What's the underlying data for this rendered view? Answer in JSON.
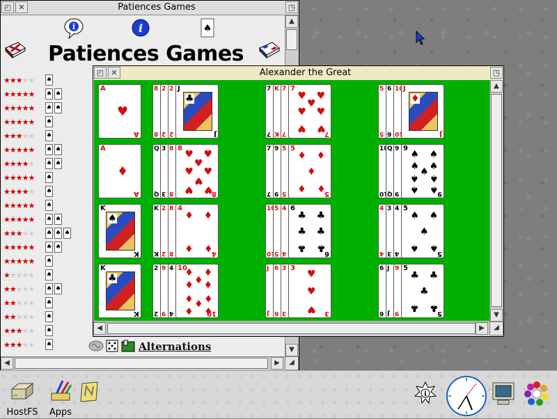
{
  "desktop": {
    "pointer_icon": "arrow-pointer-icon"
  },
  "patiences_window": {
    "title": "Patiences Games",
    "heading": "Patiences Games",
    "toolbar": {
      "help_icon": "help-bubble-icon",
      "info_icon": "info-icon",
      "card_icon": "spade-card-icon"
    },
    "language_icons": [
      "uk-book-icon",
      "fr-book-icon"
    ],
    "rows": [
      {
        "rating": 3,
        "cards": 1
      },
      {
        "rating": 5,
        "cards": 2
      },
      {
        "rating": 5,
        "cards": 2
      },
      {
        "rating": 5,
        "cards": 1
      },
      {
        "rating": 3,
        "cards": 1
      },
      {
        "rating": 5,
        "cards": 2
      },
      {
        "rating": 4,
        "cards": 2
      },
      {
        "rating": 5,
        "cards": 1
      },
      {
        "rating": 4,
        "cards": 1
      },
      {
        "rating": 5,
        "cards": 1
      },
      {
        "rating": 5,
        "cards": 2
      },
      {
        "rating": 3,
        "cards": 3
      },
      {
        "rating": 5,
        "cards": 2
      },
      {
        "rating": 5,
        "cards": 1
      },
      {
        "rating": 1,
        "cards": 1
      },
      {
        "rating": 2,
        "cards": 2
      },
      {
        "rating": 2,
        "cards": 1
      },
      {
        "rating": 2,
        "cards": 1
      },
      {
        "rating": 3,
        "cards": 1
      },
      {
        "rating": 3,
        "cards": 1
      }
    ],
    "visible_entry": "Alternations"
  },
  "alexander_window": {
    "title": "Alexander the Great",
    "felt_color": "#00b000",
    "piles": [
      {
        "strips": [],
        "card": {
          "rank": "A",
          "suit": "♥",
          "color": "red",
          "kind": "pip",
          "pips": 1
        }
      },
      {
        "strips": [
          {
            "rank": "8",
            "color": "red"
          },
          {
            "rank": "2",
            "color": "red"
          },
          {
            "rank": "2",
            "color": "red"
          }
        ],
        "card": {
          "rank": "J",
          "suit": "♣",
          "color": "blk",
          "kind": "face"
        }
      },
      {
        "strips": [
          {
            "rank": "7",
            "color": "blk"
          },
          {
            "rank": "K",
            "color": "red"
          },
          {
            "rank": "7",
            "color": "red"
          }
        ],
        "card": {
          "rank": "7",
          "suit": "♥",
          "color": "red",
          "kind": "pip",
          "pips": 7
        }
      },
      {
        "strips": [
          {
            "rank": "5",
            "color": "red"
          },
          {
            "rank": "6",
            "color": "blk"
          },
          {
            "rank": "10",
            "color": "red"
          }
        ],
        "card": {
          "rank": "J",
          "suit": "♦",
          "color": "red",
          "kind": "face"
        }
      },
      {
        "strips": [],
        "card": {
          "rank": "A",
          "suit": "♦",
          "color": "red",
          "kind": "pip",
          "pips": 1
        }
      },
      {
        "strips": [
          {
            "rank": "Q",
            "color": "blk"
          },
          {
            "rank": "3",
            "color": "blk"
          },
          {
            "rank": "8",
            "color": "red"
          }
        ],
        "card": {
          "rank": "8",
          "suit": "♥",
          "color": "red",
          "kind": "pip",
          "pips": 8
        }
      },
      {
        "strips": [
          {
            "rank": "7",
            "color": "blk"
          },
          {
            "rank": "9",
            "color": "blk"
          },
          {
            "rank": "5",
            "color": "red"
          }
        ],
        "card": {
          "rank": "5",
          "suit": "♦",
          "color": "red",
          "kind": "pip",
          "pips": 5
        }
      },
      {
        "strips": [
          {
            "rank": "10",
            "color": "blk"
          },
          {
            "rank": "Q",
            "color": "blk"
          },
          {
            "rank": "9",
            "color": "blk"
          }
        ],
        "card": {
          "rank": "9",
          "suit": "♠",
          "color": "blk",
          "kind": "pip",
          "pips": 9
        }
      },
      {
        "strips": [],
        "card": {
          "rank": "K",
          "suit": "♠",
          "color": "blk",
          "kind": "face"
        }
      },
      {
        "strips": [
          {
            "rank": "K",
            "color": "blk"
          },
          {
            "rank": "2",
            "color": "red"
          },
          {
            "rank": "8",
            "color": "red"
          }
        ],
        "card": {
          "rank": "4",
          "suit": "♦",
          "color": "red",
          "kind": "pip",
          "pips": 4
        }
      },
      {
        "strips": [
          {
            "rank": "10",
            "color": "red"
          },
          {
            "rank": "5",
            "color": "red"
          },
          {
            "rank": "4",
            "color": "red"
          }
        ],
        "card": {
          "rank": "6",
          "suit": "♣",
          "color": "blk",
          "kind": "pip",
          "pips": 6
        }
      },
      {
        "strips": [
          {
            "rank": "4",
            "color": "red"
          },
          {
            "rank": "3",
            "color": "blk"
          },
          {
            "rank": "4",
            "color": "blk"
          }
        ],
        "card": {
          "rank": "5",
          "suit": "♠",
          "color": "blk",
          "kind": "pip",
          "pips": 5
        }
      },
      {
        "strips": [],
        "card": {
          "rank": "K",
          "suit": "♣",
          "color": "blk",
          "kind": "face"
        }
      },
      {
        "strips": [
          {
            "rank": "2",
            "color": "blk"
          },
          {
            "rank": "9",
            "color": "red"
          },
          {
            "rank": "4",
            "color": "blk"
          }
        ],
        "card": {
          "rank": "10",
          "suit": "♦",
          "color": "red",
          "kind": "pip",
          "pips": 10
        }
      },
      {
        "strips": [
          {
            "rank": "J",
            "color": "red"
          },
          {
            "rank": "6",
            "color": "red"
          },
          {
            "rank": "3",
            "color": "red"
          }
        ],
        "card": {
          "rank": "3",
          "suit": "♥",
          "color": "red",
          "kind": "pip",
          "pips": 3
        }
      },
      {
        "strips": [
          {
            "rank": "6",
            "color": "blk"
          },
          {
            "rank": "J",
            "color": "blk"
          },
          {
            "rank": "9",
            "color": "red"
          }
        ],
        "card": {
          "rank": "5",
          "suit": "♣",
          "color": "blk",
          "kind": "pip",
          "pips": 5
        }
      }
    ]
  },
  "iconbar": {
    "left": [
      {
        "label": "HostFS",
        "icon": "hard-disc-icon"
      },
      {
        "label": "Apps",
        "icon": "apps-folder-icon"
      },
      {
        "label": "",
        "icon": "notepad-icon"
      }
    ],
    "right": [
      {
        "icon": "info-sun-icon"
      },
      {
        "icon": "clock-icon"
      },
      {
        "icon": "display-monitor-icon"
      },
      {
        "icon": "colour-palette-icon"
      }
    ]
  }
}
